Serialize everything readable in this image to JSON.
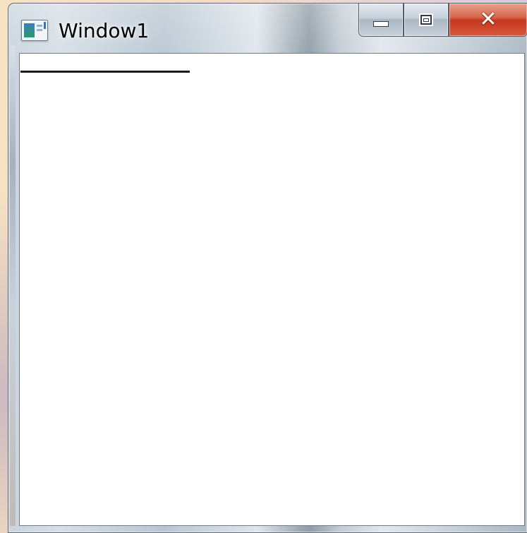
{
  "window": {
    "title": "Window1",
    "app_icon": "window-app-icon"
  },
  "caption_buttons": {
    "minimize_icon": "minimize-icon",
    "maximize_icon": "maximize-icon",
    "close_icon": "close-icon",
    "close_glyph": "✕",
    "close_color": "#c4381f"
  },
  "client": {
    "background": "#ffffff",
    "line_color": "#1a1a1a"
  }
}
